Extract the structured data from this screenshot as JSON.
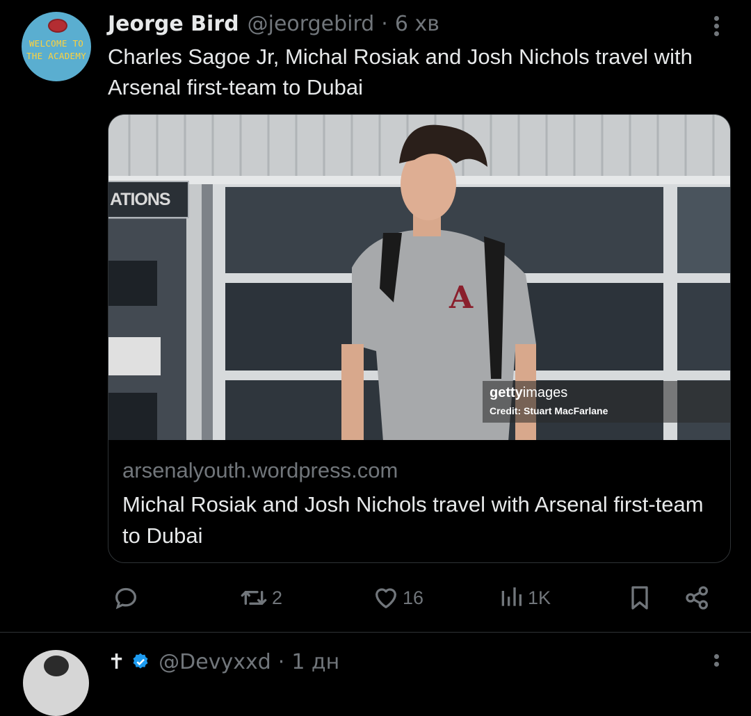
{
  "tweet": {
    "avatar": {
      "line1": "WELCOME TO",
      "line2": "THE ACADEMY"
    },
    "author_name": "Jeorge Bird",
    "author_handle": "@jeorgebird",
    "separator": "·",
    "time": "6 хв",
    "text": "Charles Sagoe Jr, Michal Rosiak and Josh Nichols travel with Arsenal first-team to Dubai",
    "card": {
      "photo_sign_text": "ATIONS",
      "watermark_logo_bold": "getty",
      "watermark_logo_light": "images",
      "watermark_credit": "Credit: Stuart MacFarlane",
      "domain": "arsenalyouth.wordpress.com",
      "title": "Michal Rosiak and Josh Nichols travel with Arsenal first-team to Dubai"
    },
    "actions": {
      "reply": {
        "icon": "reply-icon",
        "count": ""
      },
      "retweet": {
        "icon": "retweet-icon",
        "count": "2"
      },
      "like": {
        "icon": "heart-icon",
        "count": "16"
      },
      "views": {
        "icon": "views-icon",
        "count": "1K"
      },
      "bookmark": {
        "icon": "bookmark-icon"
      },
      "share": {
        "icon": "share-icon"
      }
    }
  },
  "next_tweet": {
    "prefix": "✝",
    "handle": "@Devyxxd",
    "separator": "·",
    "time": "1 дн"
  },
  "colors": {
    "background": "#000000",
    "text": "#e7e9ea",
    "muted": "#71767b",
    "border": "#2f3336",
    "verified": "#1d9bf0"
  }
}
